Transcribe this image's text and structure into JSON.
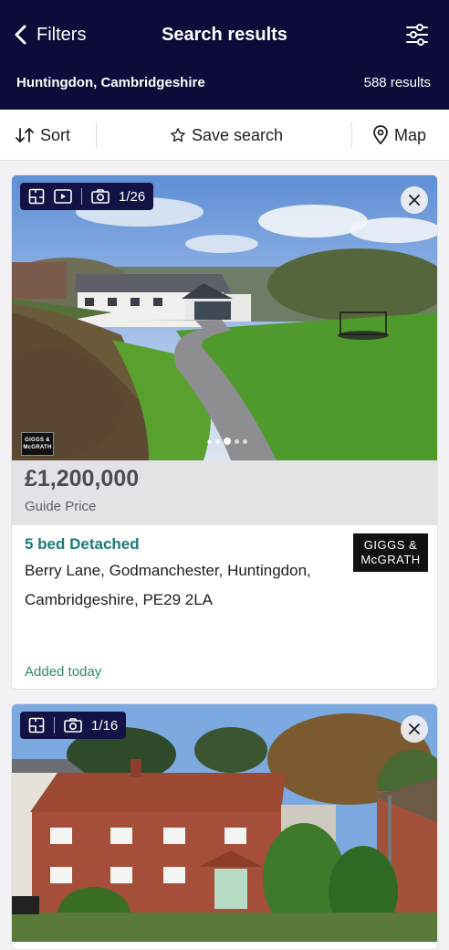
{
  "header": {
    "back_label": "Filters",
    "title": "Search results",
    "location": "Huntingdon, Cambridgeshire",
    "results_count": "588 results",
    "filter_icon": "sliders-icon"
  },
  "toolbar": {
    "sort_label": "Sort",
    "save_label": "Save search",
    "map_label": "Map"
  },
  "listings": [
    {
      "media_counter": "1/26",
      "has_floorplan": true,
      "has_video": true,
      "watermark": "GIGGS & McGRATH",
      "price": "£1,200,000",
      "price_qualifier": "Guide Price",
      "property_type": "5 bed Detached",
      "address": "Berry Lane, Godmanchester, Huntingdon, Cambridgeshire, PE29 2LA",
      "agent_logo_line1": "GIGGS &",
      "agent_logo_line2": "McGRATH",
      "added": "Added today"
    },
    {
      "media_counter": "1/16",
      "has_floorplan": true,
      "has_video": false
    }
  ],
  "colors": {
    "header_bg": "#0c0b3a",
    "accent_teal": "#1c7a78",
    "added_green": "#2e8d6c"
  }
}
